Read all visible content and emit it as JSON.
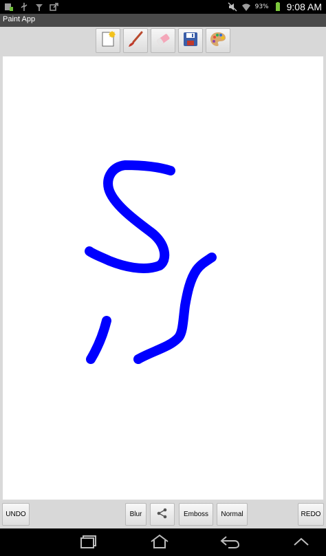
{
  "status_bar": {
    "battery_percent": "93%",
    "time": "9:08 AM",
    "icons": [
      "notification-icon",
      "usb-icon",
      "signal-icon",
      "upload-icon",
      "mute-icon",
      "wifi-icon",
      "battery-icon"
    ]
  },
  "app": {
    "title": "Paint App"
  },
  "toolbar": {
    "tools": [
      "new-canvas-icon",
      "brush-icon",
      "eraser-icon",
      "save-icon",
      "palette-icon"
    ]
  },
  "canvas": {
    "stroke_color": "#0000ff",
    "background": "#ffffff"
  },
  "bottom_bar": {
    "undo_label": "UNDO",
    "blur_label": "Blur",
    "share_icon": "share-icon",
    "emboss_label": "Emboss",
    "normal_label": "Normal",
    "redo_label": "REDO"
  },
  "nav_bar": {
    "icons": [
      "back-icon",
      "home-icon",
      "recent-apps-icon"
    ]
  }
}
